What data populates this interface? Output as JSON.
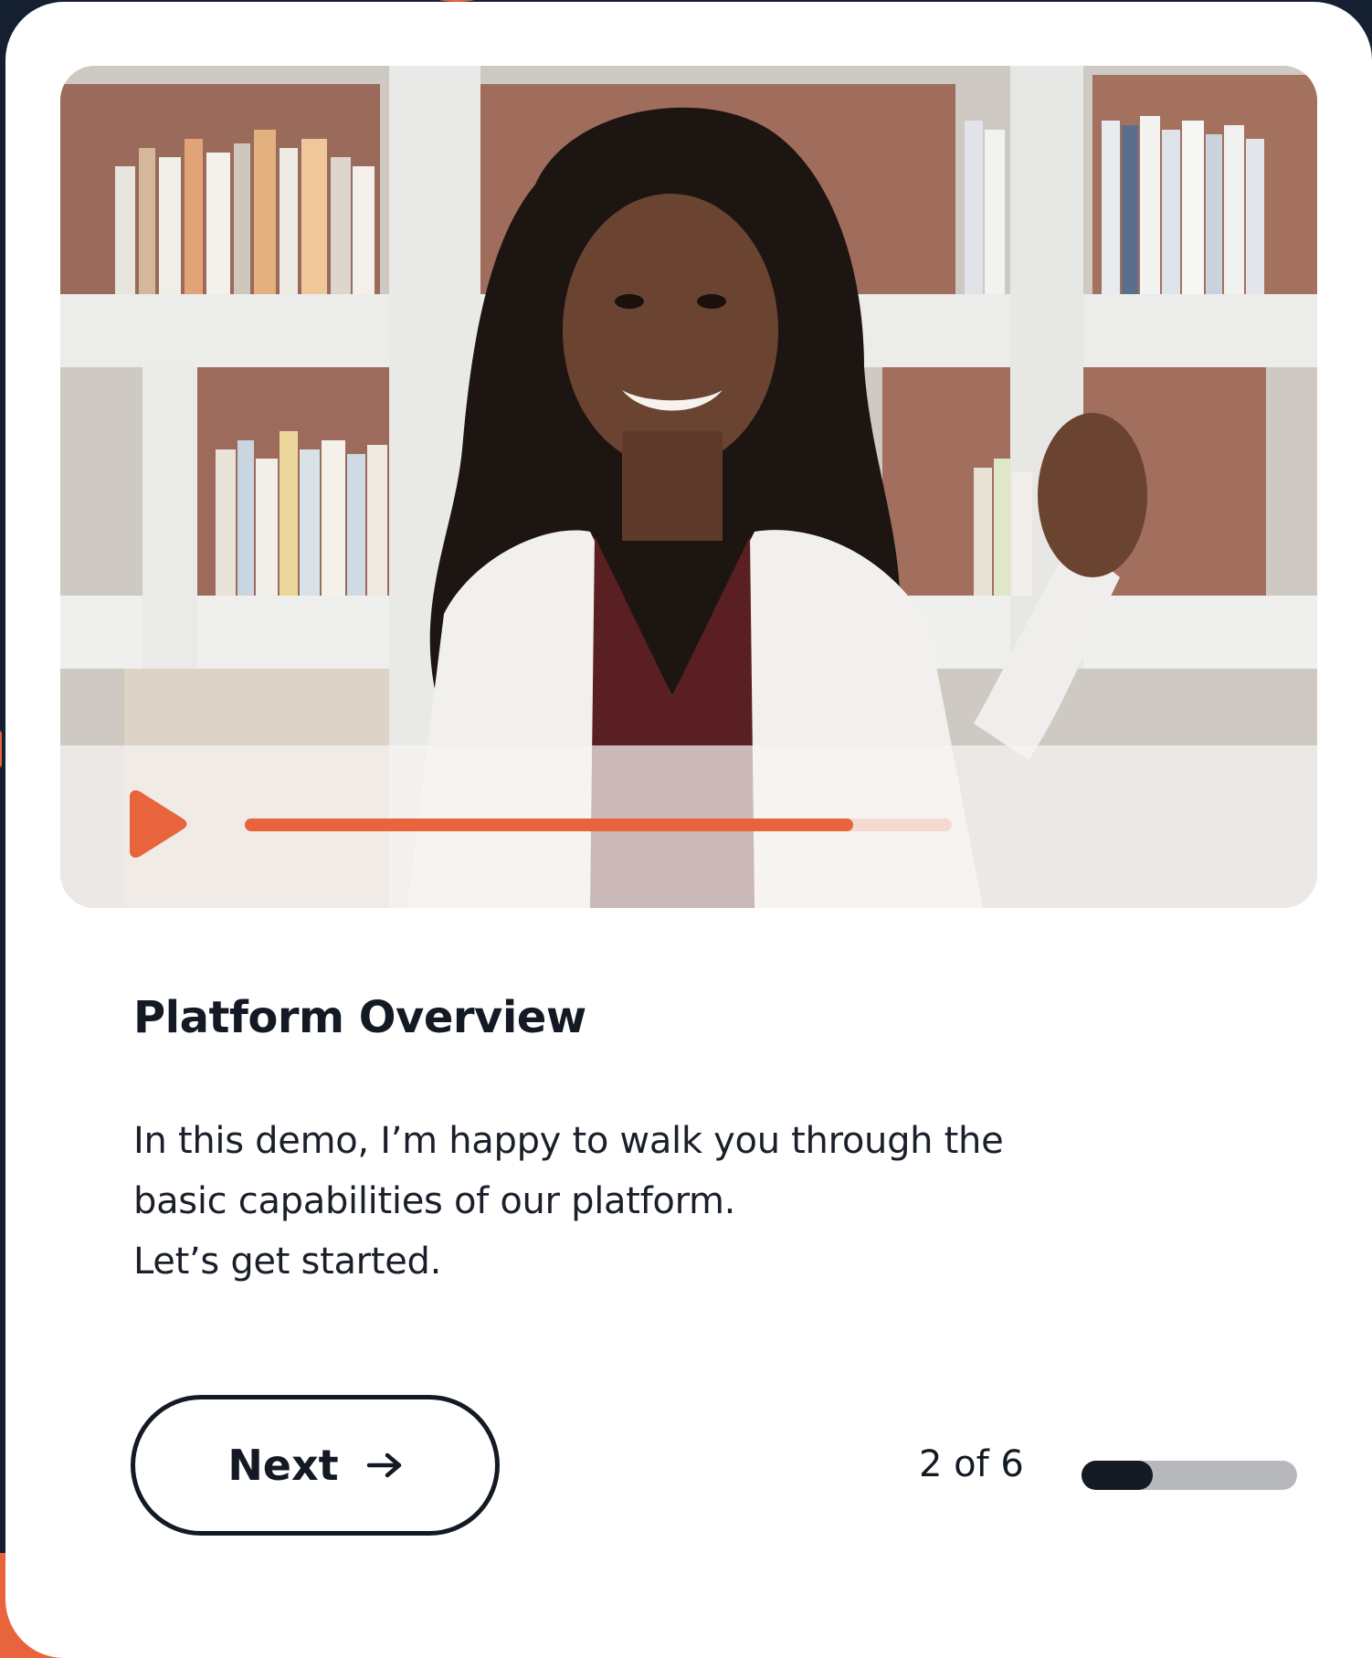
{
  "video": {
    "playback_progress": 0.86
  },
  "content": {
    "title": "Platform Overview",
    "description_lines": [
      "In this demo, I’m happy to walk you through the",
      "basic capabilities of our platform.",
      "Let’s get started."
    ]
  },
  "footer": {
    "next_label": "Next",
    "next_icon": "arrow-right-icon",
    "step_text": "2 of 6",
    "current_step": 2,
    "total_steps": 6,
    "step_progress": 0.33
  },
  "colors": {
    "accent": "#e8643c",
    "dark": "#131a24",
    "track": "#b7b8bc",
    "background": "#14202f",
    "card": "#ffffff"
  }
}
